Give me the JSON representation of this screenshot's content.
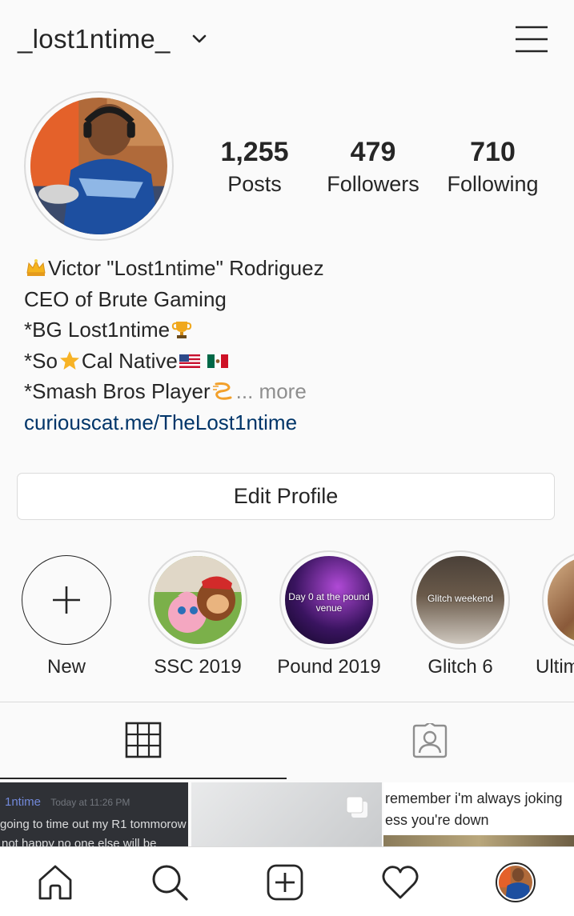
{
  "header": {
    "username": "_lost1ntime_",
    "chevron_icon": "chevron-down-icon",
    "menu_icon": "hamburger-menu-icon"
  },
  "stats": [
    {
      "value": "1,255",
      "label": "Posts"
    },
    {
      "value": "479",
      "label": "Followers"
    },
    {
      "value": "710",
      "label": "Following"
    }
  ],
  "bio": {
    "name": "Victor \"Lost1ntime\" Rodriguez",
    "line2": "CEO of Brute Gaming",
    "line3": "*BG Lost1ntime",
    "line4a": "*So",
    "line4b": "Cal Native",
    "line5": "*Smash Bros Player",
    "more": "... more",
    "link": "curiouscat.me/TheLost1ntime"
  },
  "edit_profile_label": "Edit Profile",
  "highlights": [
    {
      "label": "New",
      "caption": ""
    },
    {
      "label": "SSC 2019",
      "caption": ""
    },
    {
      "label": "Pound 2019",
      "caption": "Day 0 at the pound venue"
    },
    {
      "label": "Glitch 6",
      "caption": "Glitch weekend"
    },
    {
      "label": "Ultim",
      "caption": ""
    }
  ],
  "tabs": {
    "grid_icon": "grid-icon",
    "tagged_icon": "tagged-person-icon"
  },
  "posts": {
    "p1_name": "1ntime",
    "p1_time": "Today at 11:26 PM",
    "p1_text": "going to time out my R1 tommorow",
    "p1_text2": "not happy no one else will be",
    "p3_line1": "remember i'm always joking",
    "p3_line2": "ess you're down"
  },
  "nav": {
    "home_icon": "home-icon",
    "search_icon": "search-icon",
    "add_icon": "add-post-icon",
    "heart_icon": "heart-icon",
    "profile_icon": "profile-avatar"
  },
  "colors": {
    "link": "#003569",
    "more": "#8e8e8e",
    "border": "#dbdbdb",
    "text": "#262626"
  }
}
